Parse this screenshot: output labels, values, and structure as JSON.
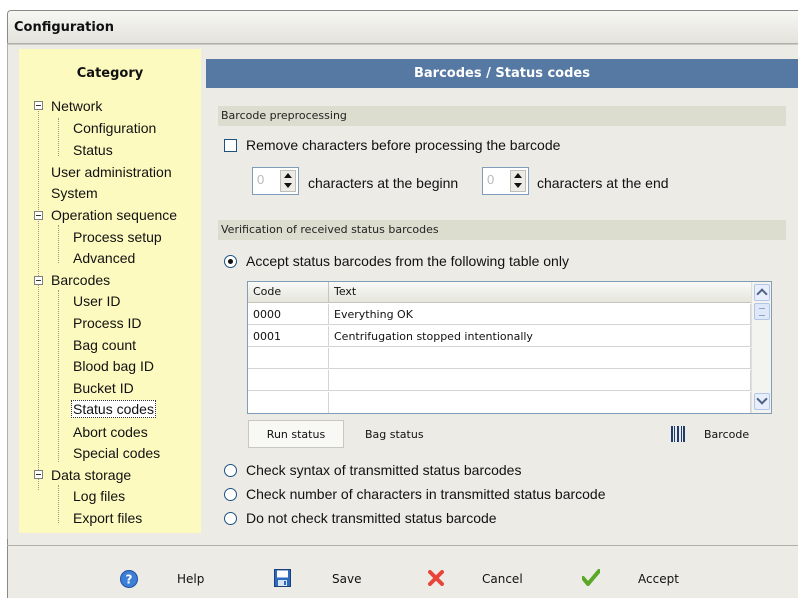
{
  "window": {
    "title": "Configuration"
  },
  "category": {
    "title": "Category",
    "items": [
      {
        "label": "Network"
      },
      {
        "label": "Configuration"
      },
      {
        "label": "Status"
      },
      {
        "label": "User administration"
      },
      {
        "label": "System"
      },
      {
        "label": "Operation sequence"
      },
      {
        "label": "Process setup"
      },
      {
        "label": "Advanced"
      },
      {
        "label": "Barcodes"
      },
      {
        "label": "User ID"
      },
      {
        "label": "Process ID"
      },
      {
        "label": "Bag count"
      },
      {
        "label": "Blood bag ID"
      },
      {
        "label": "Bucket ID"
      },
      {
        "label": "Status codes"
      },
      {
        "label": "Abort codes"
      },
      {
        "label": "Special codes"
      },
      {
        "label": "Data storage"
      },
      {
        "label": "Log files"
      },
      {
        "label": "Export files"
      }
    ]
  },
  "main": {
    "header": "Barcodes / Status codes",
    "preprocessing": {
      "section_label": "Barcode preprocessing",
      "remove_label": "Remove characters before processing the barcode",
      "begin_value": "0",
      "begin_label": "characters at the beginn",
      "end_value": "0",
      "end_label": "characters at the end"
    },
    "verification": {
      "section_label": "Verification of received status barcodes",
      "accept_label": "Accept status barcodes from the following table only",
      "table": {
        "columns": [
          "Code",
          "Text"
        ],
        "rows": [
          {
            "code": "0000",
            "text": "Everything OK"
          },
          {
            "code": "0001",
            "text": "Centrifugation stopped intentionally"
          }
        ]
      },
      "tabs": {
        "run_status": "Run status",
        "bag_status": "Bag status",
        "barcode": "Barcode"
      },
      "check_syntax_label": "Check syntax of transmitted status barcodes",
      "check_number_label": "Check number of characters in transmitted status barcode",
      "no_check_label": "Do not check transmitted status barcode"
    }
  },
  "footer": {
    "help": "Help",
    "save": "Save",
    "cancel": "Cancel",
    "accept": "Accept"
  },
  "colors": {
    "header_blue": "#5679a4",
    "category_bg": "#fdfabf",
    "section_bg": "#dcdccf"
  }
}
